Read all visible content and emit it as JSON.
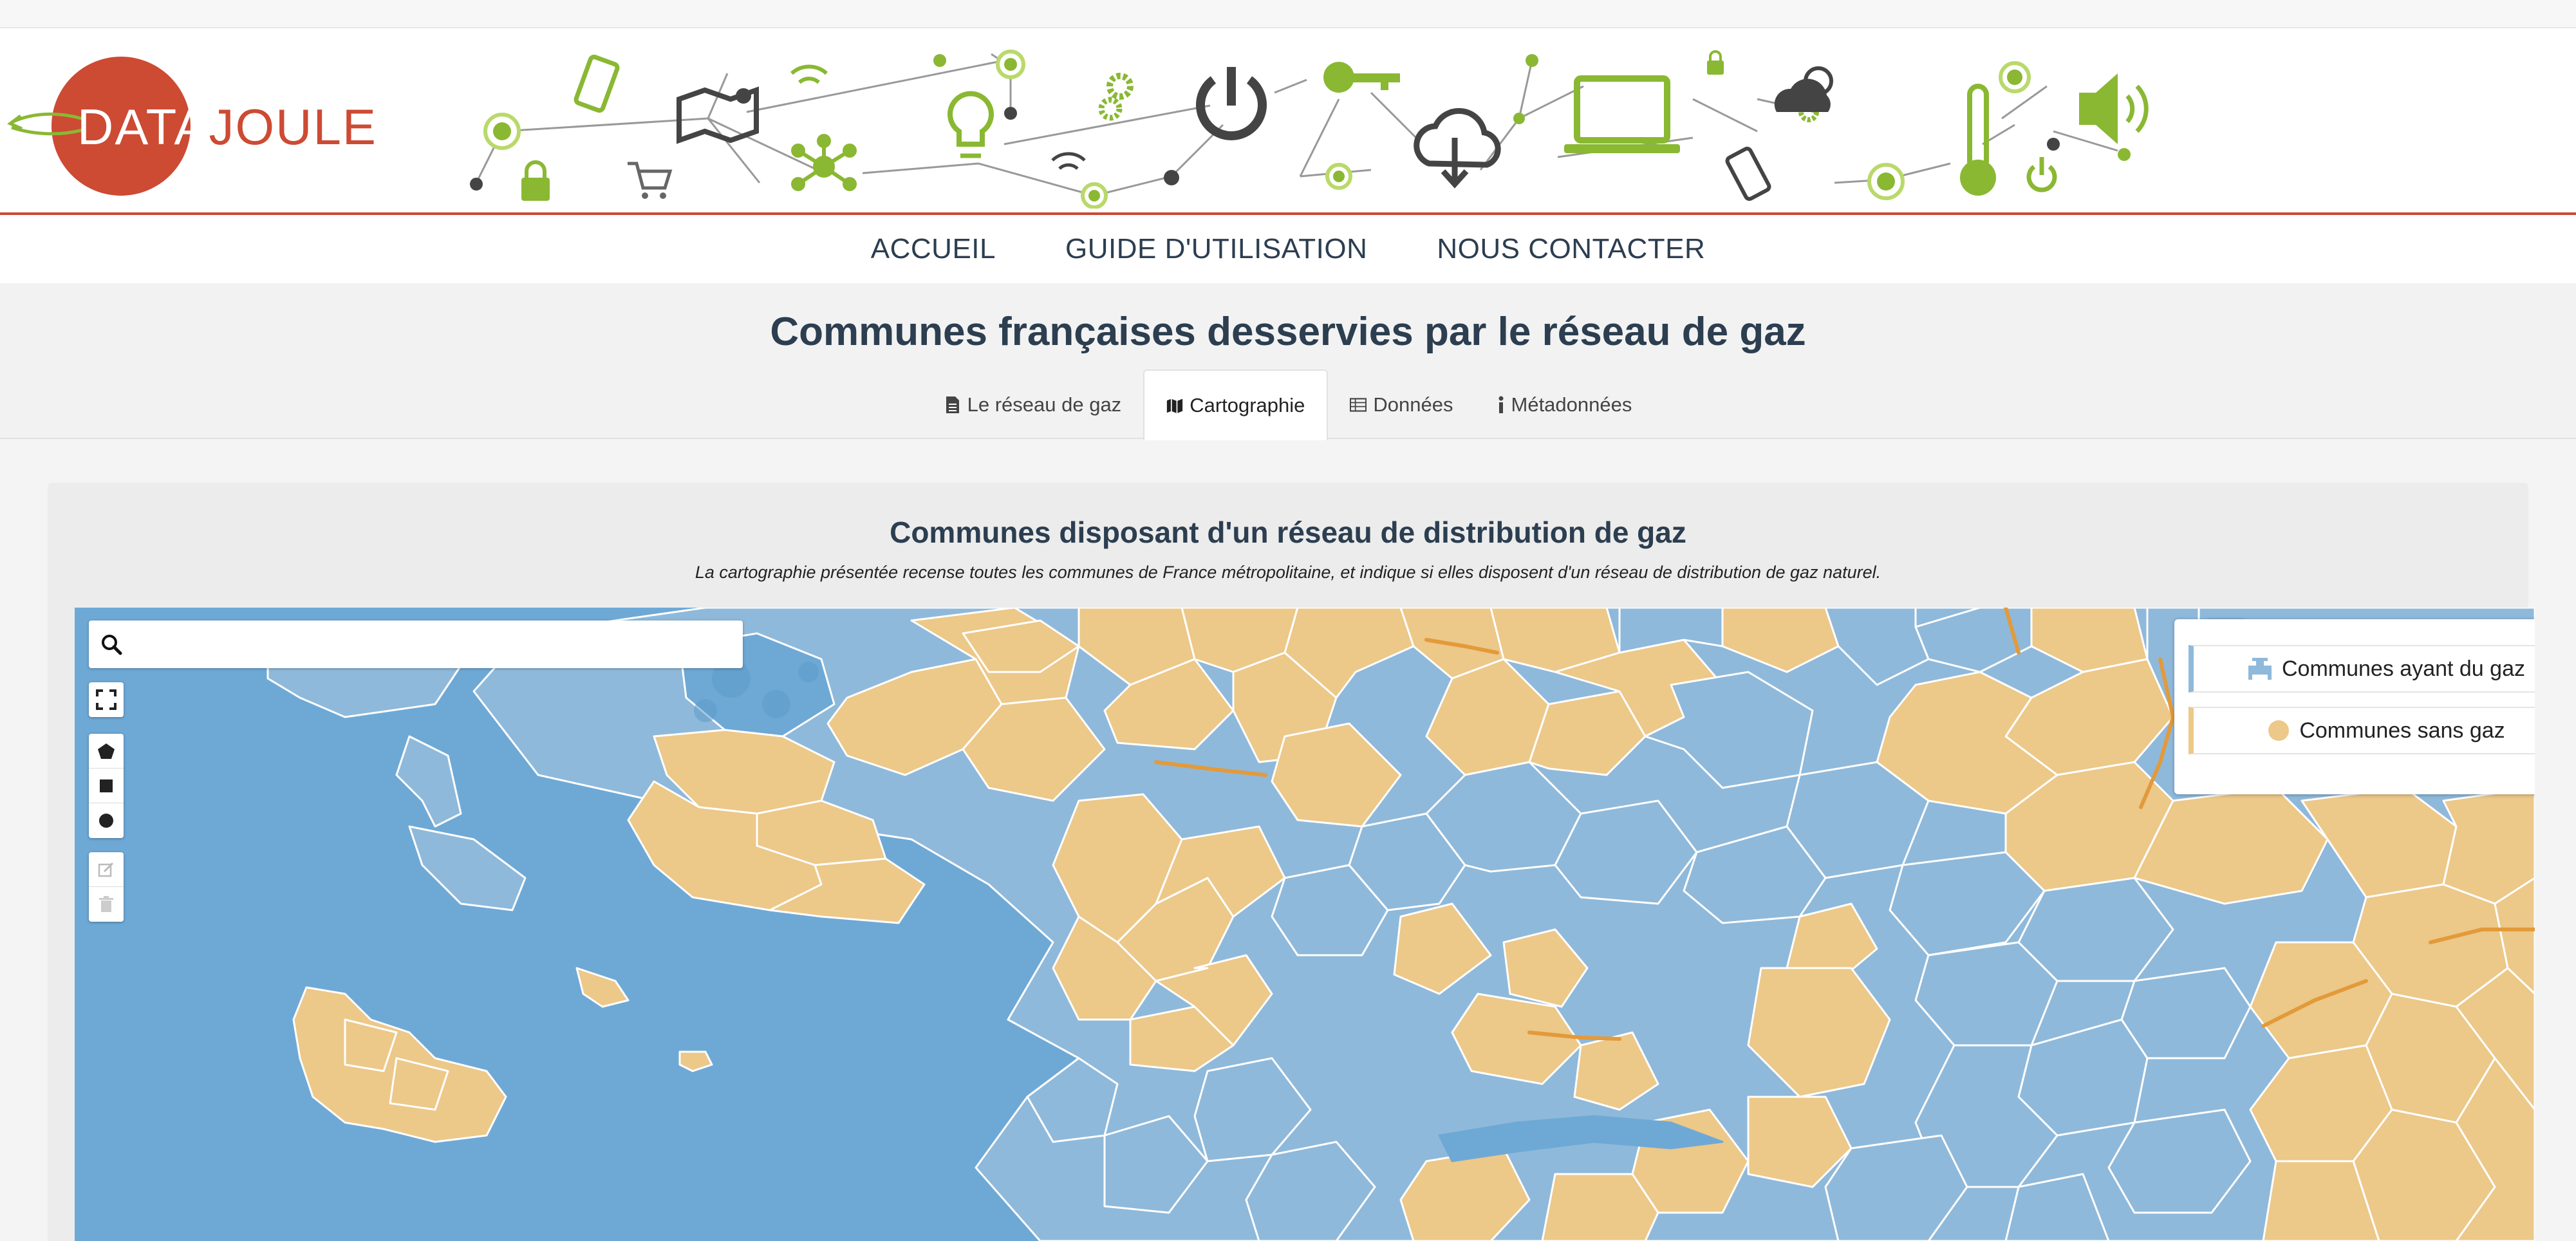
{
  "brand": {
    "name_part1": "DATA",
    "name_part2": "JOULE",
    "color": "#cd4a33"
  },
  "nav": [
    {
      "label": "ACCUEIL"
    },
    {
      "label": "GUIDE D'UTILISATION"
    },
    {
      "label": "NOUS CONTACTER"
    }
  ],
  "page_title": "Communes françaises desservies par le réseau de gaz",
  "tabs": [
    {
      "label": "Le réseau de gaz",
      "icon": "document-icon",
      "active": false
    },
    {
      "label": "Cartographie",
      "icon": "map-icon",
      "active": true
    },
    {
      "label": "Données",
      "icon": "table-icon",
      "active": false
    },
    {
      "label": "Métadonnées",
      "icon": "info-icon",
      "active": false
    }
  ],
  "map_section": {
    "title": "Communes disposant d'un réseau de distribution de gaz",
    "subtitle": "La cartographie présentée recense toutes les communes de France métropolitaine, et indique si elles disposent d'un réseau de distribution de gaz naturel.",
    "search": {
      "value": "",
      "placeholder": ""
    },
    "zoom_in": "+",
    "zoom_out": "−",
    "tools": [
      "fullscreen-icon",
      "polygon-icon",
      "rectangle-icon",
      "circle-icon",
      "edit-icon",
      "trash-icon",
      "locate-icon"
    ],
    "legend": [
      {
        "label": "Communes ayant du gaz",
        "color": "#8fb9da",
        "icon": "gas-pipe-icon"
      },
      {
        "label": "Communes sans gaz",
        "color": "#ecc889",
        "icon": "dot-icon"
      }
    ],
    "colors": {
      "sea": "#6ea9d6",
      "with_gas": "#8fb9da",
      "without_gas": "#ecc889"
    }
  }
}
